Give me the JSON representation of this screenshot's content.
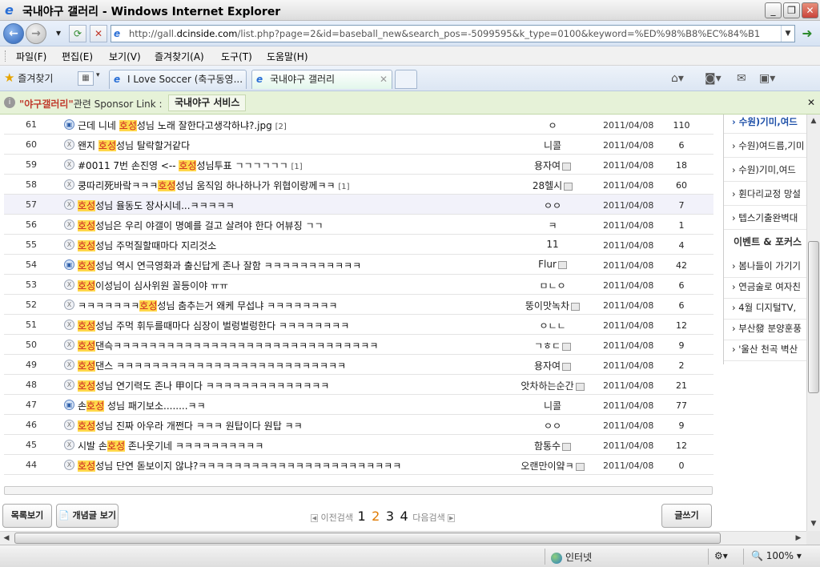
{
  "window": {
    "title": "국내야구 갤러리 - Windows Internet Explorer",
    "min": "_",
    "max": "❐",
    "close": "✕"
  },
  "address": {
    "url_prefix": "http://gall.",
    "url_domain": "dcinside.com",
    "url_rest": "/list.php?page=2&id=baseball_new&search_pos=-5099595&k_type=0100&keyword=%ED%98%B8%EC%84%B1"
  },
  "menu": [
    "파일(F)",
    "편집(E)",
    "보기(V)",
    "즐겨찾기(A)",
    "도구(T)",
    "도움말(H)"
  ],
  "tabs": {
    "favorites": "즐겨찾기",
    "tab1": "I Love Soccer (축구동영...",
    "tab2": "국내야구 갤러리"
  },
  "sponsor": {
    "keyword": "\"야구갤러리\"",
    "middle": "관련 Sponsor Link :",
    "link": "국내야구 서비스"
  },
  "rows": [
    {
      "num": "61",
      "icon": "img",
      "pre": "근데 니네 ",
      "hl": "호성",
      "post": "성님 노래 잘한다고생각하냐?.jpg",
      "cm": "[2]",
      "writer": "ㅇ",
      "gicon": false,
      "date": "2011/04/08",
      "hits": "110"
    },
    {
      "num": "60",
      "icon": "txt",
      "pre": "왠지 ",
      "hl": "호성",
      "post": "성님 탈락할거같다",
      "cm": "",
      "writer": "니콜",
      "gicon": false,
      "date": "2011/04/08",
      "hits": "6"
    },
    {
      "num": "59",
      "icon": "txt",
      "pre": "#0011 7번 손진영 <-- ",
      "hl": "호성",
      "post": "성님투표 ㄱㄱㄱㄱㄱㄱ",
      "cm": "[1]",
      "writer": "용자여",
      "gicon": true,
      "date": "2011/04/08",
      "hits": "18"
    },
    {
      "num": "58",
      "icon": "txt",
      "pre": "쿵따리死바랔ㅋㅋㅋ",
      "hl": "호성",
      "post": "성님 움직임 하나하나가 위협이랑께ㅋㅋ",
      "cm": "[1]",
      "writer": "28헬시",
      "gicon": true,
      "date": "2011/04/08",
      "hits": "60"
    },
    {
      "num": "57",
      "icon": "txt",
      "pre": "",
      "hl": "호성",
      "post": "성님 율동도 장사시네...ㅋㅋㅋㅋㅋ",
      "cm": "",
      "writer": "ㅇㅇ",
      "gicon": false,
      "date": "2011/04/08",
      "hits": "7"
    },
    {
      "num": "56",
      "icon": "txt",
      "pre": "",
      "hl": "호성",
      "post": "성님은 우리 야갤이 명예를 걸고 살려야 한다 어뷰징 ㄱㄱ",
      "cm": "",
      "writer": "ㅋ",
      "gicon": false,
      "date": "2011/04/08",
      "hits": "1"
    },
    {
      "num": "55",
      "icon": "txt",
      "pre": "",
      "hl": "호성",
      "post": "성님 주먹질할때마다 지리것소",
      "cm": "",
      "writer": "11",
      "gicon": false,
      "date": "2011/04/08",
      "hits": "4"
    },
    {
      "num": "54",
      "icon": "img",
      "pre": "",
      "hl": "호성",
      "post": "성님 역시 연극영화과 출신답게 존나 잘함 ㅋㅋㅋㅋㅋㅋㅋㅋㅋㅋㅋ",
      "cm": "",
      "writer": "Flur",
      "gicon": true,
      "date": "2011/04/08",
      "hits": "42"
    },
    {
      "num": "53",
      "icon": "txt",
      "pre": "",
      "hl": "호성",
      "post": "이성님이 심사위원 꼴등이야 ㅠㅠ",
      "cm": "",
      "writer": "ㅁㄴㅇ",
      "gicon": false,
      "date": "2011/04/08",
      "hits": "6"
    },
    {
      "num": "52",
      "icon": "txt",
      "pre": "ㅋㅋㅋㅋㅋㅋㅋ",
      "hl": "호성",
      "post": "성님 춤추는거 왜케 무섭냐 ㅋㅋㅋㅋㅋㅋㅋㅋ",
      "cm": "",
      "writer": "뚱이맛녹차",
      "gicon": true,
      "date": "2011/04/08",
      "hits": "6"
    },
    {
      "num": "51",
      "icon": "txt",
      "pre": "",
      "hl": "호성",
      "post": "성님 주먹 휘두를때마다 심장이 벌렁벌렁한다 ㅋㅋㅋㅋㅋㅋㅋㅋ",
      "cm": "",
      "writer": "ㅇㄴㄴ",
      "gicon": false,
      "date": "2011/04/08",
      "hits": "12"
    },
    {
      "num": "50",
      "icon": "txt",
      "pre": "",
      "hl": "호성",
      "post": "댄슥ㅋㅋㅋㅋㅋㅋㅋㅋㅋㅋㅋㅋㅋㅋㅋㅋㅋㅋㅋㅋㅋㅋㅋㅋㅋㅋㅋㅋㅋㅋ",
      "cm": "",
      "writer": "ㄱㅎㄷ",
      "gicon": true,
      "date": "2011/04/08",
      "hits": "9"
    },
    {
      "num": "49",
      "icon": "txt",
      "pre": "",
      "hl": "호성",
      "post": "댄스 ㅋㅋㅋㅋㅋㅋㅋㅋㅋㅋㅋㅋㅋㅋㅋㅋㅋㅋㅋㅋㅋㅋㅋㅋㅋㅋ",
      "cm": "",
      "writer": "용자여",
      "gicon": true,
      "date": "2011/04/08",
      "hits": "2"
    },
    {
      "num": "48",
      "icon": "txt",
      "pre": "",
      "hl": "호성",
      "post": "성님 연기력도 존나 甲이다 ㅋㅋㅋㅋㅋㅋㅋㅋㅋㅋㅋㅋㅋㅋ",
      "cm": "",
      "writer": "앗차하는순간",
      "gicon": true,
      "date": "2011/04/08",
      "hits": "21"
    },
    {
      "num": "47",
      "icon": "img",
      "pre": "손",
      "hl": "호성",
      "post": " 성님 패기보소........ㅋㅋ",
      "cm": "",
      "writer": "니콜",
      "gicon": false,
      "date": "2011/04/08",
      "hits": "77"
    },
    {
      "num": "46",
      "icon": "txt",
      "pre": "",
      "hl": "호성",
      "post": "성님 진짜 아우라 개쩐다 ㅋㅋㅋ 원탑이다 원탑 ㅋㅋ",
      "cm": "",
      "writer": "ㅇㅇ",
      "gicon": false,
      "date": "2011/04/08",
      "hits": "9"
    },
    {
      "num": "45",
      "icon": "txt",
      "pre": "시발 손",
      "hl": "호성",
      "post": " 존나웃기네 ㅋㅋㅋㅋㅋㅋㅋㅋㅋㅋ",
      "cm": "",
      "writer": "함통수",
      "gicon": true,
      "date": "2011/04/08",
      "hits": "12"
    },
    {
      "num": "44",
      "icon": "txt",
      "pre": "",
      "hl": "호성",
      "post": "성님 단연 돋보이지 않냐?ㅋㅋㅋㅋㅋㅋㅋㅋㅋㅋㅋㅋㅋㅋㅋㅋㅋㅋㅋㅋㅋㅋㅋ",
      "cm": "",
      "writer": "오랜만이얔ㅋ",
      "gicon": true,
      "date": "2011/04/08",
      "hits": "0"
    }
  ],
  "buttons": {
    "list": "목록보기",
    "concept": "개념글 보기",
    "write": "글쓰기"
  },
  "pager": {
    "prev": "이전검색",
    "next": "다음검색",
    "pages": [
      "1",
      "2",
      "3",
      "4"
    ],
    "current": "2"
  },
  "sidebar": {
    "items_top": [
      "수원)기미,여드",
      "수원)여드름,기미",
      "수원)기미,여드",
      "휜다리교정 망설",
      "텝스기출완벽대"
    ],
    "section_title": "이벤트 & 포커스",
    "items_bottom": [
      "봄나들이 가기기",
      "연금술로 여자친",
      "4월 디지털TV,",
      "부산發 분양훈풍",
      "'울산 천곡 벽산"
    ]
  },
  "status": {
    "zone": "인터넷",
    "zoom": "100%"
  }
}
